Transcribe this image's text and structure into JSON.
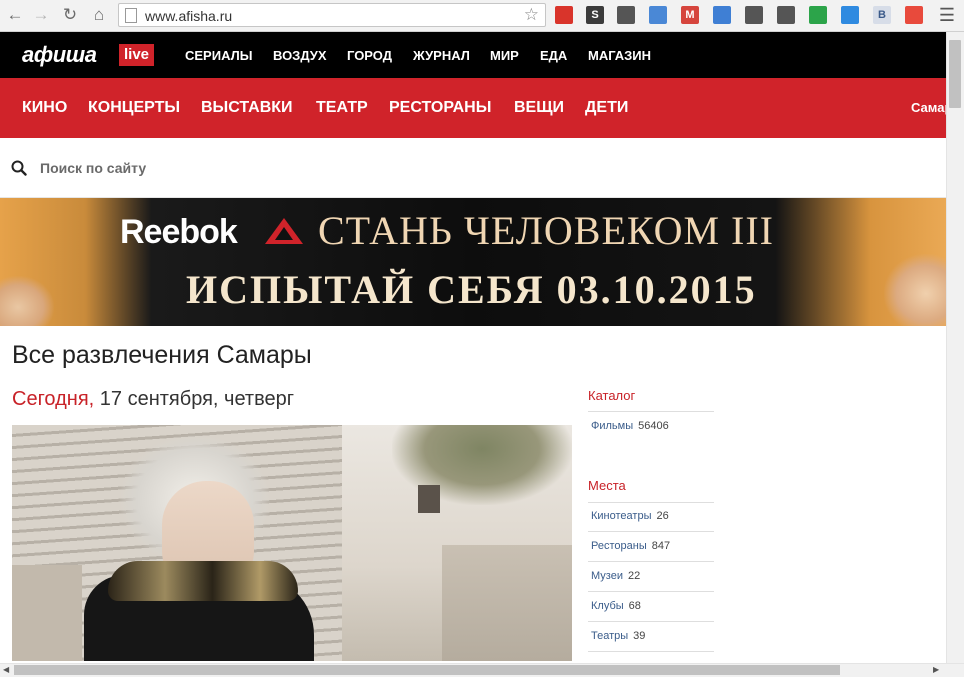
{
  "browser": {
    "url": "www.afisha.ru",
    "icons": [
      "back-icon",
      "forward-icon",
      "reload-icon",
      "home-icon",
      "page-icon",
      "bookmark-star-icon",
      "menu-icon"
    ],
    "extensions": [
      {
        "name": "book-extension-icon",
        "color": "#d9342b",
        "label": ""
      },
      {
        "name": "s-extension-icon",
        "color": "#3b3b3b",
        "label": "S"
      },
      {
        "name": "evernote-extension-icon",
        "color": "#555555",
        "label": ""
      },
      {
        "name": "star-extension-icon",
        "color": "#4a88d6",
        "label": ""
      },
      {
        "name": "gmail-extension-icon",
        "color": "#d6453d",
        "label": "M"
      },
      {
        "name": "screen-extension-icon",
        "color": "#3f7fd4",
        "label": ""
      },
      {
        "name": "leaf-extension-icon",
        "color": "#555555",
        "label": ""
      },
      {
        "name": "arrows-extension-icon",
        "color": "#555555",
        "label": ""
      },
      {
        "name": "green-drop-extension-icon",
        "color": "#2ca44a",
        "label": ""
      },
      {
        "name": "download-extension-icon",
        "color": "#2f8ae0",
        "label": ""
      },
      {
        "name": "vk-extension-icon",
        "color": "#d7dde8",
        "label": "B"
      },
      {
        "name": "colorful-extension-icon",
        "color": "#e84a3c",
        "label": ""
      }
    ]
  },
  "top_nav": {
    "logo": "афиша",
    "logo_badge": "live",
    "links": [
      "СЕРИАЛЫ",
      "ВОЗДУХ",
      "ГОРОД",
      "ЖУРНАЛ",
      "МИР",
      "ЕДА",
      "МАГАЗИН"
    ]
  },
  "red_nav": {
    "links": [
      "КИНО",
      "КОНЦЕРТЫ",
      "ВЫСТАВКИ",
      "ТЕАТР",
      "РЕСТОРАНЫ",
      "ВЕЩИ",
      "ДЕТИ"
    ],
    "city": "Самар"
  },
  "search": {
    "placeholder": "Поиск по сайту"
  },
  "banner": {
    "brand": "Reebok",
    "line1": "СТАНЬ ЧЕЛОВЕКОМ III",
    "line2": "ИСПЫТАЙ СЕБЯ 03.10.2015"
  },
  "main": {
    "title": "Все развлечения Самары",
    "date_today": "Сегодня,",
    "date_rest": " 17 сентября, четверг"
  },
  "sidebar": {
    "catalog_title": "Каталог",
    "catalog_items": [
      {
        "label": "Фильмы",
        "count": "56406"
      }
    ],
    "places_title": "Места",
    "places_items": [
      {
        "label": "Кинотеатры",
        "count": "26"
      },
      {
        "label": "Рестораны",
        "count": "847"
      },
      {
        "label": "Музеи",
        "count": "22"
      },
      {
        "label": "Клубы",
        "count": "68"
      },
      {
        "label": "Театры",
        "count": "39"
      }
    ]
  },
  "colors": {
    "brand_red": "#d0232a",
    "nav_black": "#000000",
    "link_blue": "#3a5c8a"
  }
}
